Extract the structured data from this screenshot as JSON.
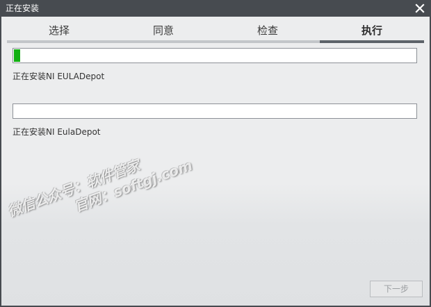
{
  "window": {
    "title": "正在安装",
    "close_icon": "close-icon"
  },
  "tabs": [
    {
      "label": "选择",
      "active": false
    },
    {
      "label": "同意",
      "active": false
    },
    {
      "label": "检查",
      "active": false
    },
    {
      "label": "执行",
      "active": true
    }
  ],
  "overall_progress": {
    "percent": 1.5,
    "status": "正在安装NI EULADepot"
  },
  "item_progress": {
    "percent": 0,
    "status": "正在安装NI EulaDepot"
  },
  "watermark": {
    "line1": "微信公众号：软件管家",
    "line2": "官网：softgj.com"
  },
  "buttons": {
    "next_label": "下一步",
    "next_enabled": false
  },
  "colors": {
    "titlebar": "#474b50",
    "progress_fill": "#12b012",
    "active_tab_underline": "#5d6369",
    "inactive_tab_underline": "#c3c6c9"
  }
}
